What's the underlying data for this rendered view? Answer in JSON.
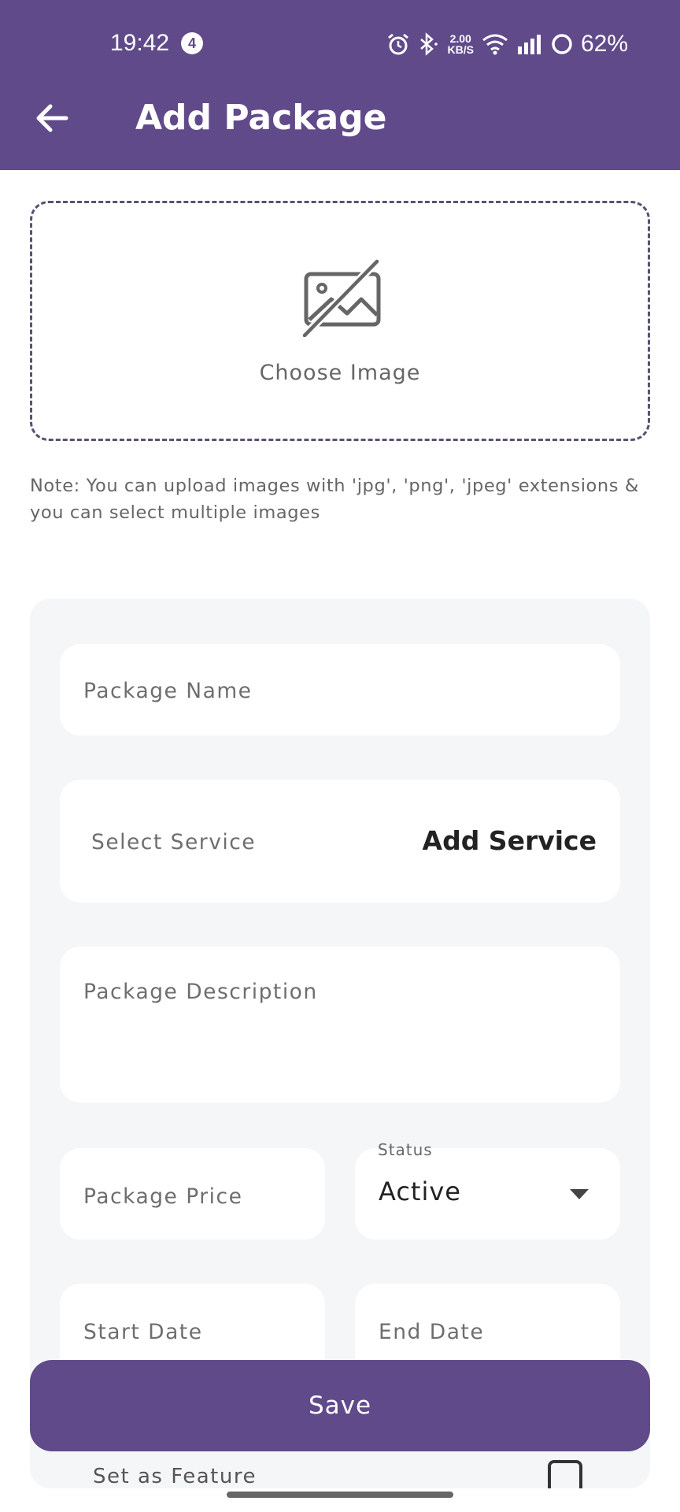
{
  "status_bar": {
    "time": "19:42",
    "notification_count": "4",
    "net_speed_value": "2.00",
    "net_speed_unit": "KB/S",
    "battery": "62%"
  },
  "header": {
    "title": "Add Package",
    "background_color": "#604a8a"
  },
  "image_picker": {
    "label": "Choose Image",
    "icon": "image-off-icon"
  },
  "note": "Note: You can upload images with 'jpg', 'png', 'jpeg' extensions & you can select multiple images",
  "form": {
    "package_name_placeholder": "Package Name",
    "select_service_placeholder": "Select Service",
    "add_service_label": "Add Service",
    "package_description_placeholder": "Package Description",
    "package_price_placeholder": "Package Price",
    "status_label": "Status",
    "status_value": "Active",
    "start_date_placeholder": "Start Date",
    "end_date_placeholder": "End Date",
    "feature_label": "Set as Feature",
    "feature_checked": false
  },
  "actions": {
    "save_label": "Save",
    "accent_color": "#604a8a"
  }
}
